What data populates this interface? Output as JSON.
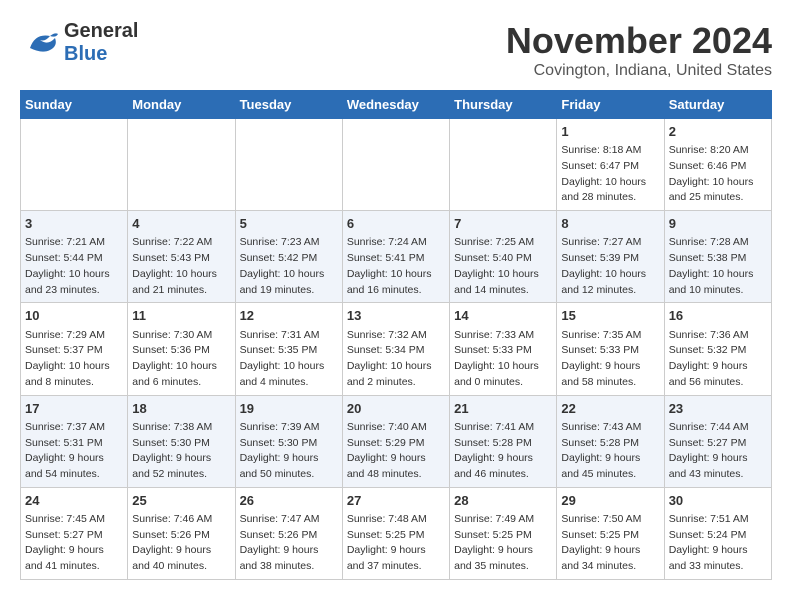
{
  "logo": {
    "name": "General",
    "name2": "Blue"
  },
  "header": {
    "month": "November 2024",
    "location": "Covington, Indiana, United States"
  },
  "weekdays": [
    "Sunday",
    "Monday",
    "Tuesday",
    "Wednesday",
    "Thursday",
    "Friday",
    "Saturday"
  ],
  "weeks": [
    [
      {
        "day": "",
        "info": ""
      },
      {
        "day": "",
        "info": ""
      },
      {
        "day": "",
        "info": ""
      },
      {
        "day": "",
        "info": ""
      },
      {
        "day": "",
        "info": ""
      },
      {
        "day": "1",
        "info": "Sunrise: 8:18 AM\nSunset: 6:47 PM\nDaylight: 10 hours and 28 minutes."
      },
      {
        "day": "2",
        "info": "Sunrise: 8:20 AM\nSunset: 6:46 PM\nDaylight: 10 hours and 25 minutes."
      }
    ],
    [
      {
        "day": "3",
        "info": "Sunrise: 7:21 AM\nSunset: 5:44 PM\nDaylight: 10 hours and 23 minutes."
      },
      {
        "day": "4",
        "info": "Sunrise: 7:22 AM\nSunset: 5:43 PM\nDaylight: 10 hours and 21 minutes."
      },
      {
        "day": "5",
        "info": "Sunrise: 7:23 AM\nSunset: 5:42 PM\nDaylight: 10 hours and 19 minutes."
      },
      {
        "day": "6",
        "info": "Sunrise: 7:24 AM\nSunset: 5:41 PM\nDaylight: 10 hours and 16 minutes."
      },
      {
        "day": "7",
        "info": "Sunrise: 7:25 AM\nSunset: 5:40 PM\nDaylight: 10 hours and 14 minutes."
      },
      {
        "day": "8",
        "info": "Sunrise: 7:27 AM\nSunset: 5:39 PM\nDaylight: 10 hours and 12 minutes."
      },
      {
        "day": "9",
        "info": "Sunrise: 7:28 AM\nSunset: 5:38 PM\nDaylight: 10 hours and 10 minutes."
      }
    ],
    [
      {
        "day": "10",
        "info": "Sunrise: 7:29 AM\nSunset: 5:37 PM\nDaylight: 10 hours and 8 minutes."
      },
      {
        "day": "11",
        "info": "Sunrise: 7:30 AM\nSunset: 5:36 PM\nDaylight: 10 hours and 6 minutes."
      },
      {
        "day": "12",
        "info": "Sunrise: 7:31 AM\nSunset: 5:35 PM\nDaylight: 10 hours and 4 minutes."
      },
      {
        "day": "13",
        "info": "Sunrise: 7:32 AM\nSunset: 5:34 PM\nDaylight: 10 hours and 2 minutes."
      },
      {
        "day": "14",
        "info": "Sunrise: 7:33 AM\nSunset: 5:33 PM\nDaylight: 10 hours and 0 minutes."
      },
      {
        "day": "15",
        "info": "Sunrise: 7:35 AM\nSunset: 5:33 PM\nDaylight: 9 hours and 58 minutes."
      },
      {
        "day": "16",
        "info": "Sunrise: 7:36 AM\nSunset: 5:32 PM\nDaylight: 9 hours and 56 minutes."
      }
    ],
    [
      {
        "day": "17",
        "info": "Sunrise: 7:37 AM\nSunset: 5:31 PM\nDaylight: 9 hours and 54 minutes."
      },
      {
        "day": "18",
        "info": "Sunrise: 7:38 AM\nSunset: 5:30 PM\nDaylight: 9 hours and 52 minutes."
      },
      {
        "day": "19",
        "info": "Sunrise: 7:39 AM\nSunset: 5:30 PM\nDaylight: 9 hours and 50 minutes."
      },
      {
        "day": "20",
        "info": "Sunrise: 7:40 AM\nSunset: 5:29 PM\nDaylight: 9 hours and 48 minutes."
      },
      {
        "day": "21",
        "info": "Sunrise: 7:41 AM\nSunset: 5:28 PM\nDaylight: 9 hours and 46 minutes."
      },
      {
        "day": "22",
        "info": "Sunrise: 7:43 AM\nSunset: 5:28 PM\nDaylight: 9 hours and 45 minutes."
      },
      {
        "day": "23",
        "info": "Sunrise: 7:44 AM\nSunset: 5:27 PM\nDaylight: 9 hours and 43 minutes."
      }
    ],
    [
      {
        "day": "24",
        "info": "Sunrise: 7:45 AM\nSunset: 5:27 PM\nDaylight: 9 hours and 41 minutes."
      },
      {
        "day": "25",
        "info": "Sunrise: 7:46 AM\nSunset: 5:26 PM\nDaylight: 9 hours and 40 minutes."
      },
      {
        "day": "26",
        "info": "Sunrise: 7:47 AM\nSunset: 5:26 PM\nDaylight: 9 hours and 38 minutes."
      },
      {
        "day": "27",
        "info": "Sunrise: 7:48 AM\nSunset: 5:25 PM\nDaylight: 9 hours and 37 minutes."
      },
      {
        "day": "28",
        "info": "Sunrise: 7:49 AM\nSunset: 5:25 PM\nDaylight: 9 hours and 35 minutes."
      },
      {
        "day": "29",
        "info": "Sunrise: 7:50 AM\nSunset: 5:25 PM\nDaylight: 9 hours and 34 minutes."
      },
      {
        "day": "30",
        "info": "Sunrise: 7:51 AM\nSunset: 5:24 PM\nDaylight: 9 hours and 33 minutes."
      }
    ]
  ]
}
